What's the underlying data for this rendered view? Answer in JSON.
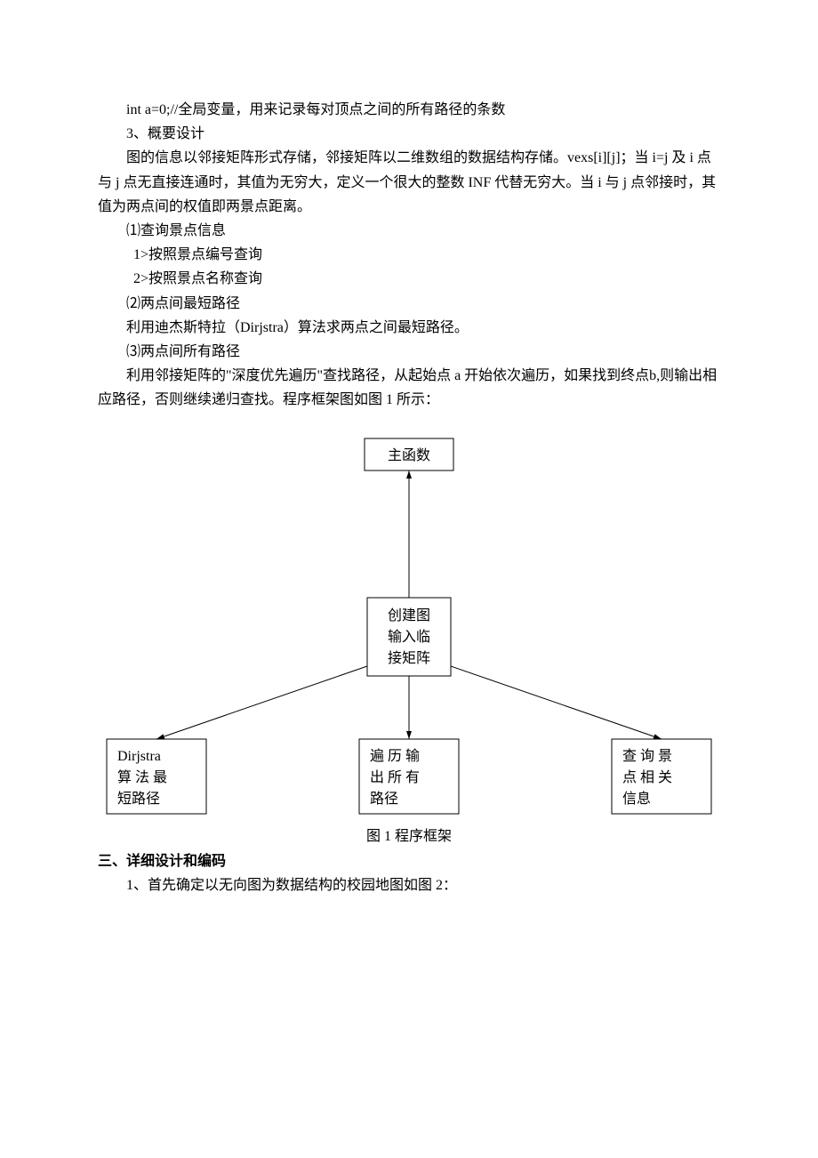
{
  "p1": "int a=0;//全局变量，用来记录每对顶点之间的所有路径的条数",
  "p2": "3、概要设计",
  "p3": "图的信息以邻接矩阵形式存储，邻接矩阵以二维数组的数据结构存储。vexs[i][j]；当 i=j 及 i 点与 j 点无直接连通时，其值为无穷大，定义一个很大的整数 INF 代替无穷大。当 i 与 j 点邻接时，其值为两点间的权值即两景点距离。",
  "p4": "⑴查询景点信息",
  "p5": "1>按照景点编号查询",
  "p6": "2>按照景点名称查询",
  "p7": "⑵两点间最短路径",
  "p8": "利用迪杰斯特拉（Dirjstra）算法求两点之间最短路径。",
  "p9": "⑶两点间所有路径",
  "p10": "利用邻接矩阵的\"深度优先遍历\"查找路径，从起始点 a 开始依次遍历，如果找到终点b,则输出相应路径，否则继续递归查找。程序框架图如图 1 所示：",
  "chart_data": {
    "type": "diagram",
    "title": "图 1   程序框架",
    "nodes": {
      "main": "主函数",
      "createGraph": [
        "创建图",
        "输入临",
        "接矩阵"
      ],
      "dijkstra": [
        "Dirjstra",
        "算法最",
        "短路径"
      ],
      "traverse": [
        "遍历输",
        "出所有",
        "路径"
      ],
      "query": [
        "查询景",
        "点相关",
        "信息"
      ]
    },
    "edges": [
      {
        "from": "createGraph",
        "to": "main",
        "arrow": "to"
      },
      {
        "from": "createGraph",
        "to": "dijkstra",
        "arrow": "to"
      },
      {
        "from": "createGraph",
        "to": "traverse",
        "arrow": "to"
      },
      {
        "from": "createGraph",
        "to": "query",
        "arrow": "to"
      }
    ]
  },
  "caption": "图 1   程序框架",
  "h3": "三、详细设计和编码",
  "p11": "1、首先确定以无向图为数据结构的校园地图如图 2："
}
